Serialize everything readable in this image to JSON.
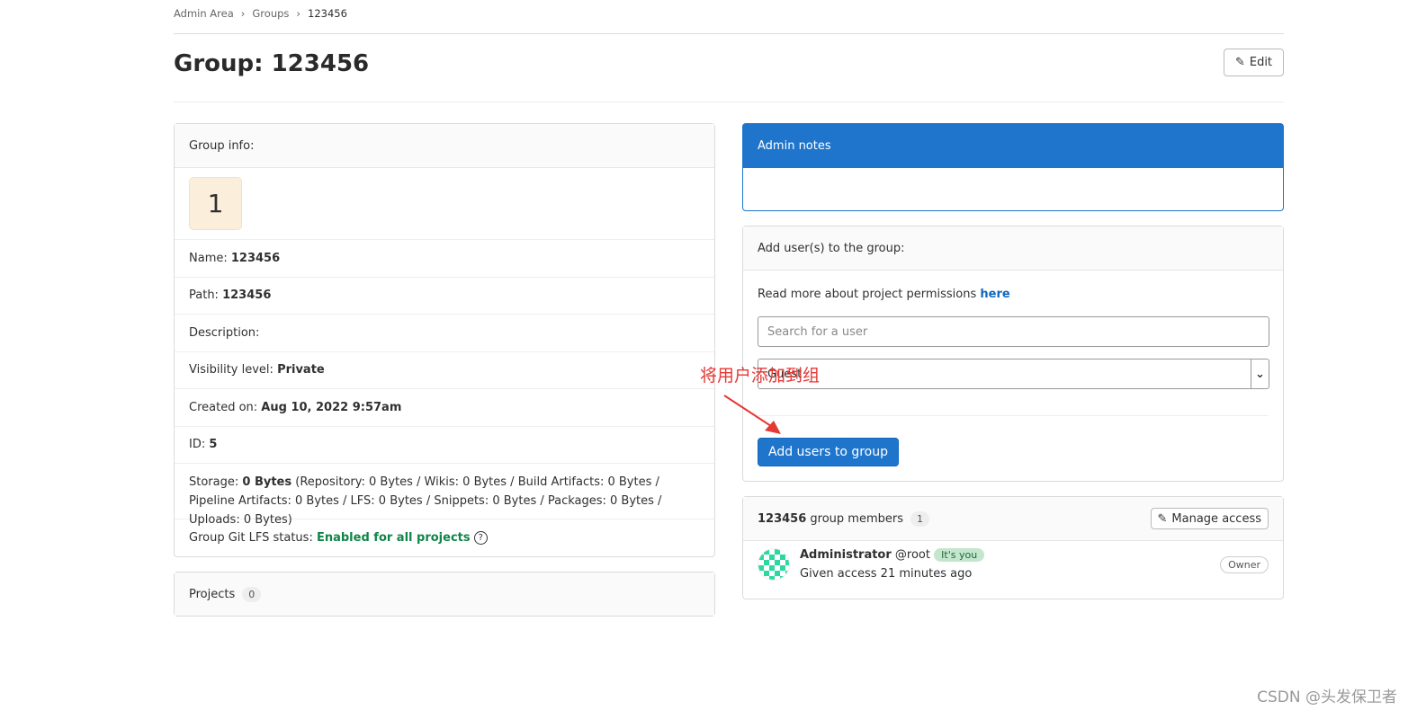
{
  "breadcrumb": [
    "Admin Area",
    "Groups",
    "123456"
  ],
  "title": "Group: 123456",
  "edit_label": "Edit",
  "group_info": {
    "header": "Group info:",
    "avatar_letter": "1",
    "name_label": "Name:",
    "name": "123456",
    "path_label": "Path:",
    "path": "123456",
    "description_label": "Description:",
    "visibility_label": "Visibility level:",
    "visibility": "Private",
    "created_label": "Created on:",
    "created": "Aug 10, 2022 9:57am",
    "id_label": "ID:",
    "id": "5",
    "storage_label": "Storage:",
    "storage": "0 Bytes",
    "storage_detail": "(Repository: 0 Bytes / Wikis: 0 Bytes / Build Artifacts: 0 Bytes / Pipeline Artifacts: 0 Bytes / LFS: 0 Bytes / Snippets: 0 Bytes / Packages: 0 Bytes / Uploads: 0 Bytes)",
    "lfs_label": "Group Git LFS status:",
    "lfs": "Enabled for all projects"
  },
  "projects": {
    "label": "Projects",
    "count": "0"
  },
  "admin_notes": {
    "header": "Admin notes",
    "color": "#1f75cb"
  },
  "add_users": {
    "header": "Add user(s) to the group:",
    "read_more": "Read more about project permissions",
    "here": "here",
    "search_placeholder": "Search for a user",
    "role": "Guest",
    "submit": "Add users to group"
  },
  "members": {
    "group": "123456",
    "label": "group members",
    "count": "1",
    "manage": "Manage access",
    "items": [
      {
        "name": "Administrator",
        "username": "@root",
        "badge": "It's you",
        "access": "Given access 21 minutes ago",
        "role": "Owner"
      }
    ]
  },
  "annotation": "将用户添加到组",
  "watermark": "CSDN @头发保卫者"
}
